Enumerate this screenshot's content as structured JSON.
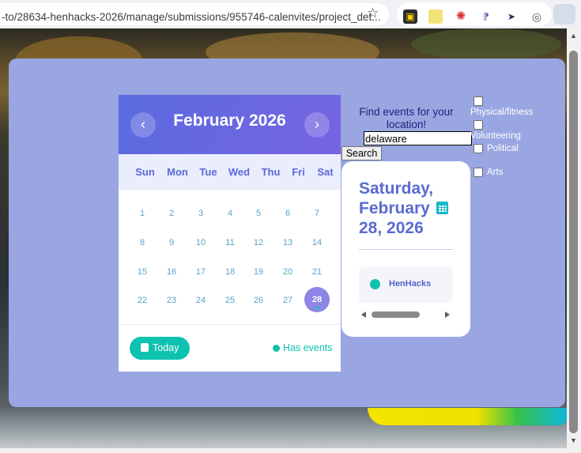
{
  "browser": {
    "url": "-to/28634-henhacks-2026/manage/submissions/955746-calenvites/project_det...",
    "icons": [
      "bookmark-star-icon",
      "extension-1-icon",
      "extension-notes-icon",
      "extension-target-icon",
      "extension-pin-icon",
      "extension-pointer-icon",
      "extension-grammarly-icon",
      "extension-active-icon"
    ]
  },
  "calendar": {
    "month_title": "February 2026",
    "prev_label": "‹",
    "next_label": "›",
    "weekdays": [
      "Sun",
      "Mon",
      "Tue",
      "Wed",
      "Thu",
      "Fri",
      "Sat"
    ],
    "weeks": [
      [
        "1",
        "2",
        "3",
        "4",
        "5",
        "6",
        "7"
      ],
      [
        "8",
        "9",
        "10",
        "11",
        "12",
        "13",
        "14"
      ],
      [
        "15",
        "16",
        "17",
        "18",
        "19",
        "20",
        "21"
      ],
      [
        "22",
        "23",
        "24",
        "25",
        "26",
        "27",
        "28"
      ]
    ],
    "selected_day": "28",
    "today_label": "Today",
    "has_events_label": "Has events",
    "accent": "#0ec2b0",
    "header_color": "#5a6bdf"
  },
  "search": {
    "prompt": "Find events for your location!",
    "location_value": "delaware",
    "button_label": "Search"
  },
  "filters": [
    {
      "label": "Physical/fitness",
      "checked": false
    },
    {
      "label": "Volunteering",
      "checked": false
    },
    {
      "label": "Political",
      "checked": false
    },
    {
      "label": "Arts",
      "checked": false
    }
  ],
  "day_card": {
    "line1": "Saturday,",
    "line2": "February",
    "line3": "28, 2026",
    "events": [
      {
        "name": "HenHacks"
      }
    ]
  }
}
